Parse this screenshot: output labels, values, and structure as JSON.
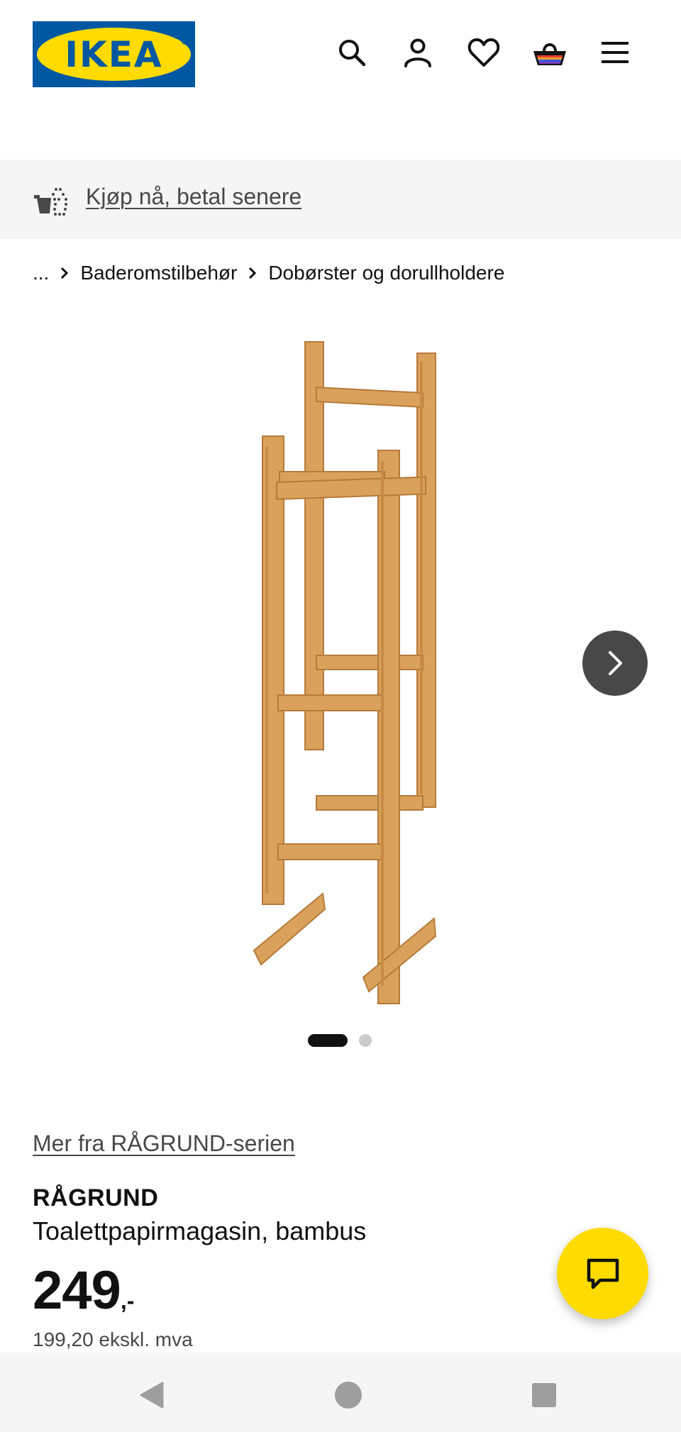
{
  "header": {
    "logo_text": "IKEA",
    "icons": [
      "search-icon",
      "account-icon",
      "heart-icon",
      "basket-icon",
      "menu-icon"
    ]
  },
  "promo": {
    "text": "Kjøp nå, betal senere",
    "icon": "buy-now-pay-later-icon"
  },
  "breadcrumb": {
    "ellipsis": "...",
    "items": [
      "Baderomstilbehør",
      "Dobørster og dorullholdere"
    ]
  },
  "gallery": {
    "image_count": 2,
    "active_index": 0,
    "next_icon": "chevron-right-icon"
  },
  "product": {
    "series_link": "Mer fra RÅGRUND-serien",
    "name": "RÅGRUND",
    "description": "Toalettpapirmagasin, bambus",
    "price": "249",
    "price_suffix": ",-",
    "price_ex_vat": "199,20 ekskl. mva"
  },
  "chat": {
    "icon": "chat-bubble-icon"
  },
  "system_nav": {
    "icons": [
      "back-icon",
      "home-icon",
      "recents-icon"
    ]
  },
  "colors": {
    "ikea_blue": "#0058a3",
    "ikea_yellow": "#ffdb00",
    "bamboo": "#d9a15c",
    "dark_button": "#484848",
    "light_bg": "#f5f5f5"
  }
}
